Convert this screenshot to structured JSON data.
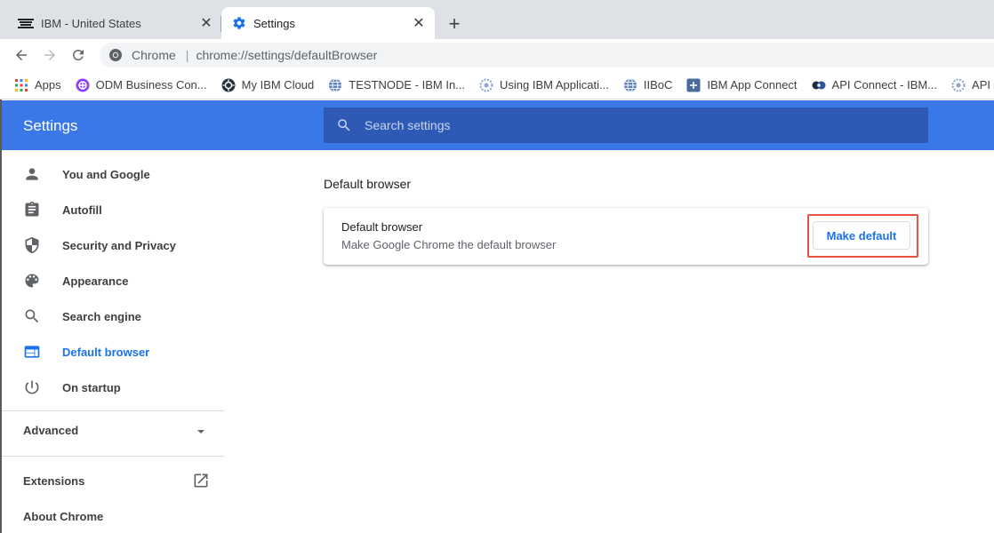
{
  "tabs": [
    {
      "title": "IBM - United States",
      "icon": "ibm-logo-icon",
      "close": "✕"
    },
    {
      "title": "Settings",
      "icon": "gear-icon",
      "close": "✕"
    }
  ],
  "new_tab_glyph": "+",
  "omnibox": {
    "site_label": "Chrome",
    "separator": "|",
    "url_scheme": "chrome://",
    "url_path": "settings/defaultBrowser"
  },
  "bookmarks": [
    {
      "label": "Apps",
      "icon": "apps-grid-icon"
    },
    {
      "label": "ODM Business Con...",
      "icon": "odm-icon"
    },
    {
      "label": "My IBM Cloud",
      "icon": "cloud-wheel-icon"
    },
    {
      "label": "TESTNODE - IBM In...",
      "icon": "globe-icon"
    },
    {
      "label": "Using IBM Applicati...",
      "icon": "gear-badge-icon"
    },
    {
      "label": "IIBoC",
      "icon": "globe-icon"
    },
    {
      "label": "IBM App Connect",
      "icon": "app-connect-icon"
    },
    {
      "label": "API Connect - IBM...",
      "icon": "api-connect-icon"
    },
    {
      "label": "API Connect Deve",
      "icon": "gear-badge-icon"
    }
  ],
  "settings": {
    "title": "Settings",
    "search_placeholder": "Search settings"
  },
  "sidebar": {
    "items": [
      {
        "label": "You and Google",
        "icon": "person-icon"
      },
      {
        "label": "Autofill",
        "icon": "clipboard-icon"
      },
      {
        "label": "Security and Privacy",
        "icon": "shield-icon"
      },
      {
        "label": "Appearance",
        "icon": "palette-icon"
      },
      {
        "label": "Search engine",
        "icon": "search-icon"
      },
      {
        "label": "Default browser",
        "icon": "browser-window-icon",
        "active": true
      },
      {
        "label": "On startup",
        "icon": "power-icon"
      }
    ],
    "advanced": "Advanced",
    "extensions": "Extensions",
    "about": "About Chrome"
  },
  "main": {
    "section_title": "Default browser",
    "card_title": "Default browser",
    "card_subtitle": "Make Google Chrome the default browser",
    "make_default_label": "Make default"
  },
  "colors": {
    "header_blue": "#3b78e7",
    "search_blue": "#2e59b5",
    "accent": "#1a73e8",
    "highlight_red": "#e8533f"
  }
}
